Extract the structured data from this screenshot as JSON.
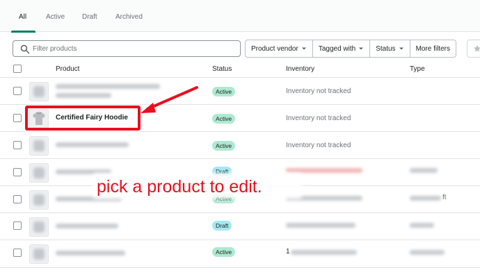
{
  "tabs": [
    {
      "label": "All",
      "active": true
    },
    {
      "label": "Active",
      "active": false
    },
    {
      "label": "Draft",
      "active": false
    },
    {
      "label": "Archived",
      "active": false
    }
  ],
  "search": {
    "placeholder": "Filter products"
  },
  "filters": [
    "Product vendor",
    "Tagged with",
    "Status",
    "More filters"
  ],
  "table": {
    "headers": {
      "product": "Product",
      "status": "Status",
      "inventory": "Inventory",
      "type": "Type"
    },
    "rows": [
      {
        "name": "",
        "status": "Active",
        "inventory": "Inventory not tracked",
        "type": ""
      },
      {
        "name": "Certified Fairy Hoodie",
        "status": "Active",
        "inventory": "Inventory not tracked",
        "type": ""
      },
      {
        "name": "",
        "status": "Active",
        "inventory": "Inventory not tracked",
        "type": ""
      },
      {
        "name": "",
        "status": "Draft",
        "inventory": "",
        "type": ""
      },
      {
        "name": "",
        "status": "Active",
        "inventory": "",
        "type": "ft"
      },
      {
        "name": "",
        "status": "Draft",
        "inventory": "",
        "type": ""
      },
      {
        "name": "",
        "status": "Active",
        "inventory": "1",
        "type": ""
      }
    ]
  },
  "annotation": {
    "text": "pick a product to edit.",
    "color": "#e8101e"
  },
  "colors": {
    "accent": "#008060",
    "active_badge": "#aee9d1",
    "draft_badge": "#a4e8f2",
    "highlight": "#e8101e"
  }
}
